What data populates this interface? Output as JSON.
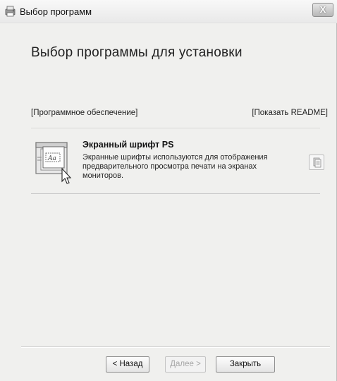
{
  "window": {
    "title": "Выбор программ",
    "close_label": "X"
  },
  "page": {
    "title": "Выбор программы для установки"
  },
  "list": {
    "header_left": "[Программное обеспечение]",
    "header_right": "[Показать README]",
    "items": [
      {
        "title": "Экранный шрифт PS",
        "description": "Экранные шрифты используются для отображения предварительного просмотра печати на экранах мониторов.",
        "icon": "font-software-icon",
        "readme_icon": "readme-document-icon"
      }
    ]
  },
  "buttons": {
    "back": "< Назад",
    "next": "Далее >",
    "close": "Закрыть",
    "next_disabled": true
  }
}
